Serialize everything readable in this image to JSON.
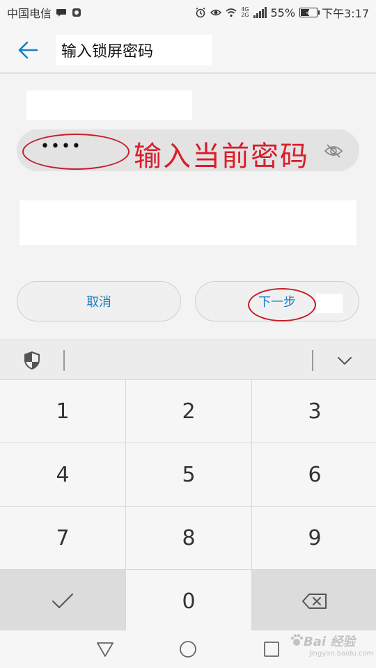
{
  "status_bar": {
    "carrier": "中国电信",
    "battery_percent": "55%",
    "battery_level": 0.55,
    "network_type_top": "4G",
    "network_type_bottom": "2G",
    "time": "下午3:17"
  },
  "header": {
    "title": "输入锁屏密码"
  },
  "form": {
    "password_masked": "••••"
  },
  "annotation": {
    "text": "输入当前密码"
  },
  "buttons": {
    "cancel": "取消",
    "next": "下一步"
  },
  "keypad": {
    "keys": [
      "1",
      "2",
      "3",
      "4",
      "5",
      "6",
      "7",
      "8",
      "9",
      "0"
    ]
  },
  "watermark": {
    "main": "Bai 经验",
    "sub": "jingyan.baidu.com"
  },
  "colors": {
    "accent": "#1a7fc1",
    "annotation": "#d81e2b"
  }
}
